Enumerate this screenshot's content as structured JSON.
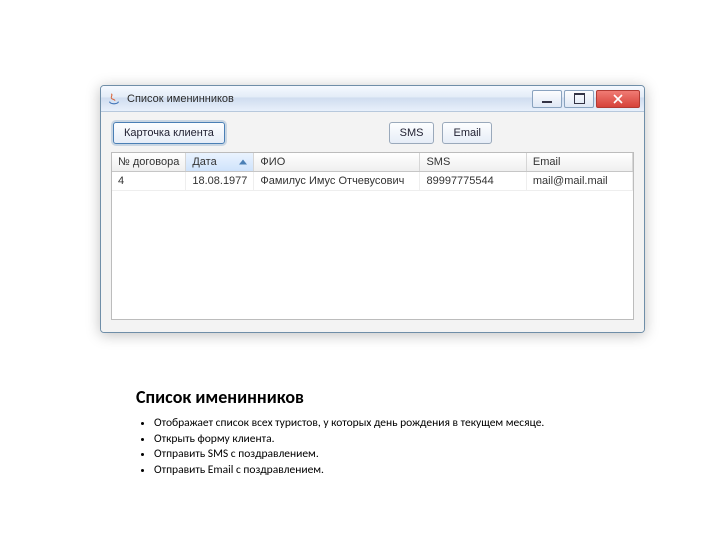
{
  "window": {
    "title": "Список именинников"
  },
  "toolbar": {
    "client_card_label": "Карточка клиента",
    "sms_label": "SMS",
    "email_label": "Email"
  },
  "table": {
    "columns": [
      "№ договора",
      "Дата",
      "ФИО",
      "SMS",
      "Email"
    ],
    "sorted_column_index": 1,
    "rows": [
      {
        "contract_no": "4",
        "date": "18.08.1977",
        "fio": "Фамилус Имус Отчевусович",
        "sms": "89997775544",
        "email": "mail@mail.mail"
      }
    ]
  },
  "description": {
    "title": "Список именинников",
    "bullets": [
      "Отображает список всех туристов, у которых день рождения в текущем месяце.",
      "Открыть форму клиента.",
      "Отправить SMS с поздравлением.",
      "Отправить Email с поздравлением."
    ]
  }
}
